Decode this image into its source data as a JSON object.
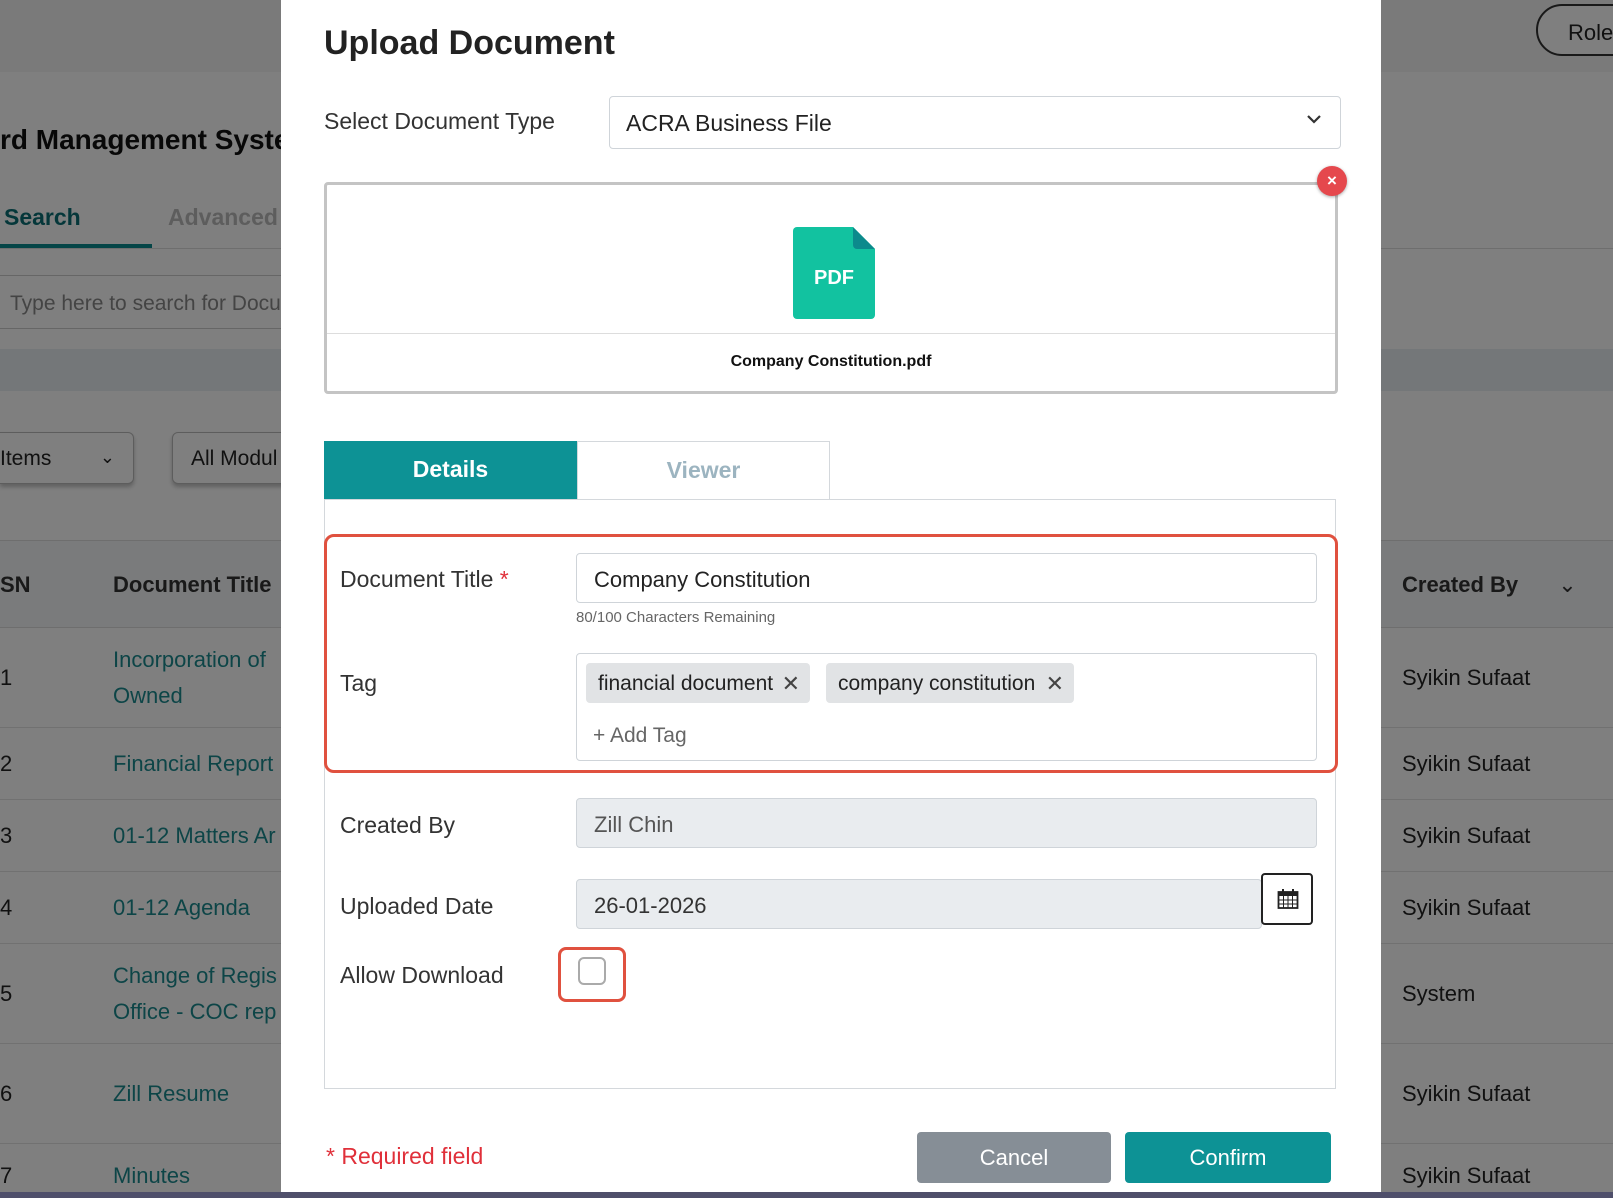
{
  "background": {
    "role_button": "Role",
    "app_title": "rd Management Syste",
    "tabs": {
      "search": "Search",
      "advanced": "Advanced"
    },
    "search_placeholder": "Type here to search for Docu",
    "items_dropdown": "Items",
    "modules_dropdown": "All Modul",
    "table": {
      "headers": {
        "sn": "SN",
        "title": "Document Title",
        "created_by": "Created By"
      },
      "rows": [
        {
          "sn": "1",
          "title_line1": "Incorporation of",
          "title_line2": "Owned",
          "created_by": "Syikin Sufaat"
        },
        {
          "sn": "2",
          "title_line1": "Financial Report",
          "title_line2": "",
          "created_by": "Syikin Sufaat"
        },
        {
          "sn": "3",
          "title_line1": "01-12 Matters Ar",
          "title_line2": "",
          "created_by": "Syikin Sufaat"
        },
        {
          "sn": "4",
          "title_line1": "01-12 Agenda",
          "title_line2": "",
          "created_by": "Syikin Sufaat"
        },
        {
          "sn": "5",
          "title_line1": "Change of Regis",
          "title_line2": "Office - COC rep",
          "created_by": "System"
        },
        {
          "sn": "6",
          "title_line1": "Zill Resume",
          "title_line2": "",
          "created_by": "Syikin Sufaat"
        },
        {
          "sn": "7",
          "title_line1": "Minutes",
          "title_line2": "",
          "created_by": "Syikin Sufaat"
        }
      ]
    }
  },
  "modal": {
    "title": "Upload Document",
    "doc_type": {
      "label": "Select Document Type",
      "value": "ACRA Business File"
    },
    "file": {
      "icon_text": "PDF",
      "name": "Company Constitution.pdf",
      "remove": "×"
    },
    "tabs": {
      "details": "Details",
      "viewer": "Viewer"
    },
    "fields": {
      "title": {
        "label": "Document Title",
        "required_mark": "*",
        "value": "Company Constitution",
        "hint": "80/100 Characters Remaining"
      },
      "tag": {
        "label": "Tag",
        "tags": [
          "financial document",
          "company constitution"
        ],
        "remove_symbol": "✕",
        "add_placeholder": "+ Add Tag"
      },
      "created_by": {
        "label": "Created By",
        "value": "Zill Chin"
      },
      "uploaded_date": {
        "label": "Uploaded Date",
        "value": "26-01-2026"
      },
      "allow_download": {
        "label": "Allow Download",
        "checked": false
      }
    },
    "required_note": "* Required field",
    "buttons": {
      "cancel": "Cancel",
      "confirm": "Confirm"
    }
  },
  "colors": {
    "accent": "#0d9295",
    "danger": "#e0513f",
    "link": "#1b8a8f"
  }
}
